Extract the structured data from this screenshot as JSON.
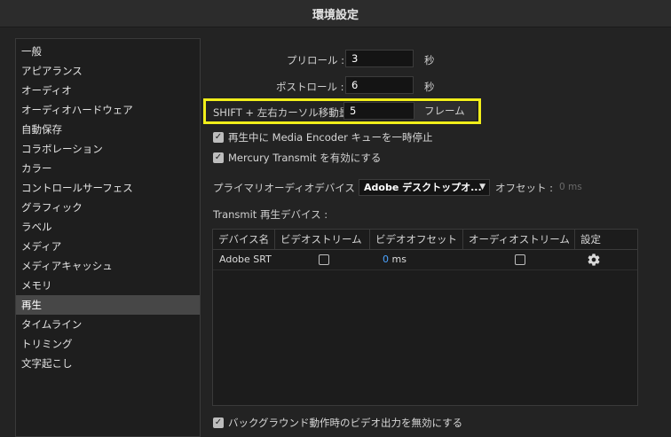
{
  "window": {
    "title": "環境設定"
  },
  "sidebar": {
    "items": [
      {
        "label": "一般"
      },
      {
        "label": "アピアランス"
      },
      {
        "label": "オーディオ"
      },
      {
        "label": "オーディオハードウェア"
      },
      {
        "label": "自動保存"
      },
      {
        "label": "コラボレーション"
      },
      {
        "label": "カラー"
      },
      {
        "label": "コントロールサーフェス"
      },
      {
        "label": "グラフィック"
      },
      {
        "label": "ラベル"
      },
      {
        "label": "メディア"
      },
      {
        "label": "メディアキャッシュ"
      },
      {
        "label": "メモリ"
      },
      {
        "label": "再生"
      },
      {
        "label": "タイムライン"
      },
      {
        "label": "トリミング"
      },
      {
        "label": "文字起こし"
      }
    ],
    "selected": "再生"
  },
  "playback": {
    "preroll": {
      "label": "プリロール :",
      "value": "3",
      "unit": "秒"
    },
    "postroll": {
      "label": "ポストロール :",
      "value": "6",
      "unit": "秒"
    },
    "shift_move": {
      "label": "SHIFT + 左右カーソル移動量 :",
      "value": "5",
      "unit": "フレーム"
    },
    "pause_media_encoder": {
      "label": "再生中に Media Encoder キューを一時停止",
      "checked": true
    },
    "mercury_transmit": {
      "label": "Mercury Transmit を有効にする",
      "checked": true
    },
    "audio_device": {
      "label": "プライマリオーディオデバイス :",
      "selected": "Adobe デスクトップオ...",
      "offset_label": "オフセット :",
      "offset_value": "0 ms"
    },
    "transmit_devices": {
      "label": "Transmit 再生デバイス :",
      "columns": [
        "デバイス名",
        "ビデオストリーム",
        "ビデオオフセット",
        "オーディオストリーム",
        "設定"
      ],
      "rows": [
        {
          "device": "Adobe SRT",
          "video_stream": false,
          "video_offset": "0",
          "video_offset_unit": "ms",
          "audio_stream": false
        }
      ]
    },
    "disable_background_video": {
      "label": "バックグラウンド動作時のビデオ出力を無効にする",
      "checked": true
    }
  },
  "colors": {
    "highlight": "#f1ee1a",
    "accent": "#4ba3ff",
    "selected_bg": "#474747"
  },
  "icons": {
    "checkmark": "checkmark-icon",
    "chevron": "chevron-down-icon",
    "gear": "gear-icon"
  }
}
